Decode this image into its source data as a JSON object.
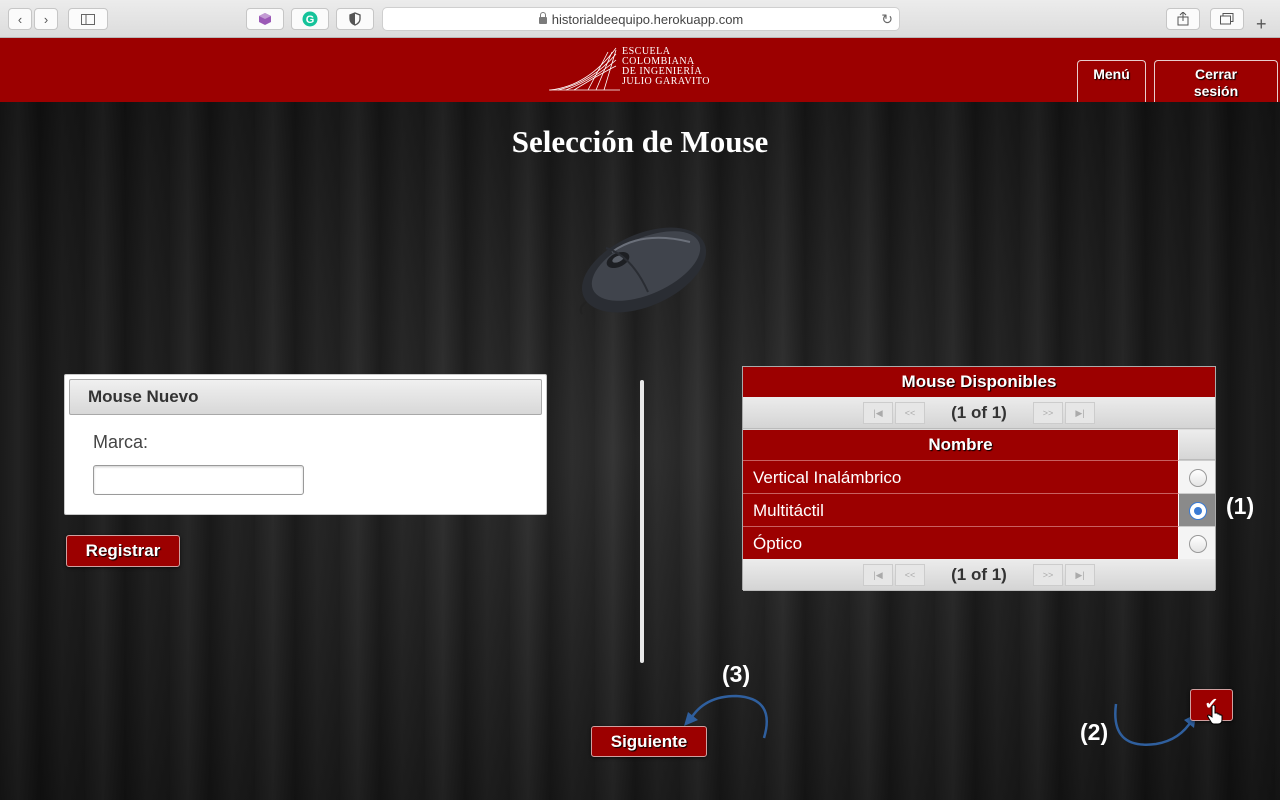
{
  "browser": {
    "url": "historialdeequipo.herokuapp.com",
    "icons": [
      "back-icon",
      "forward-icon",
      "sidebar-icon",
      "extension-cube-icon",
      "grammarly-icon",
      "shield-icon",
      "lock-icon",
      "reload-icon",
      "share-icon",
      "tabs-icon",
      "new-tab-icon"
    ]
  },
  "header": {
    "logo_lines": [
      "Escuela",
      "Colombiana",
      "de Ingeniería",
      "Julio Garavito"
    ],
    "menu_label": "Menú",
    "logout_label": "Cerrar sesión"
  },
  "page": {
    "title": "Selección de Mouse"
  },
  "new_mouse": {
    "panel_title": "Mouse Nuevo",
    "brand_label": "Marca:",
    "brand_value": "",
    "register_label": "Registrar"
  },
  "available": {
    "title": "Mouse Disponibles",
    "pager_text": "(1 of 1)",
    "column_header": "Nombre",
    "rows": [
      {
        "name": "Vertical Inalámbrico",
        "selected": false
      },
      {
        "name": "Multitáctil",
        "selected": true
      },
      {
        "name": "Óptico",
        "selected": false
      }
    ]
  },
  "actions": {
    "next_label": "Siguiente",
    "confirm_icon": "check-icon"
  },
  "annotations": {
    "a1": "(1)",
    "a2": "(2)",
    "a3": "(3)"
  },
  "colors": {
    "brand_red": "#9c0000",
    "arrow_blue": "#2f5f9e"
  }
}
